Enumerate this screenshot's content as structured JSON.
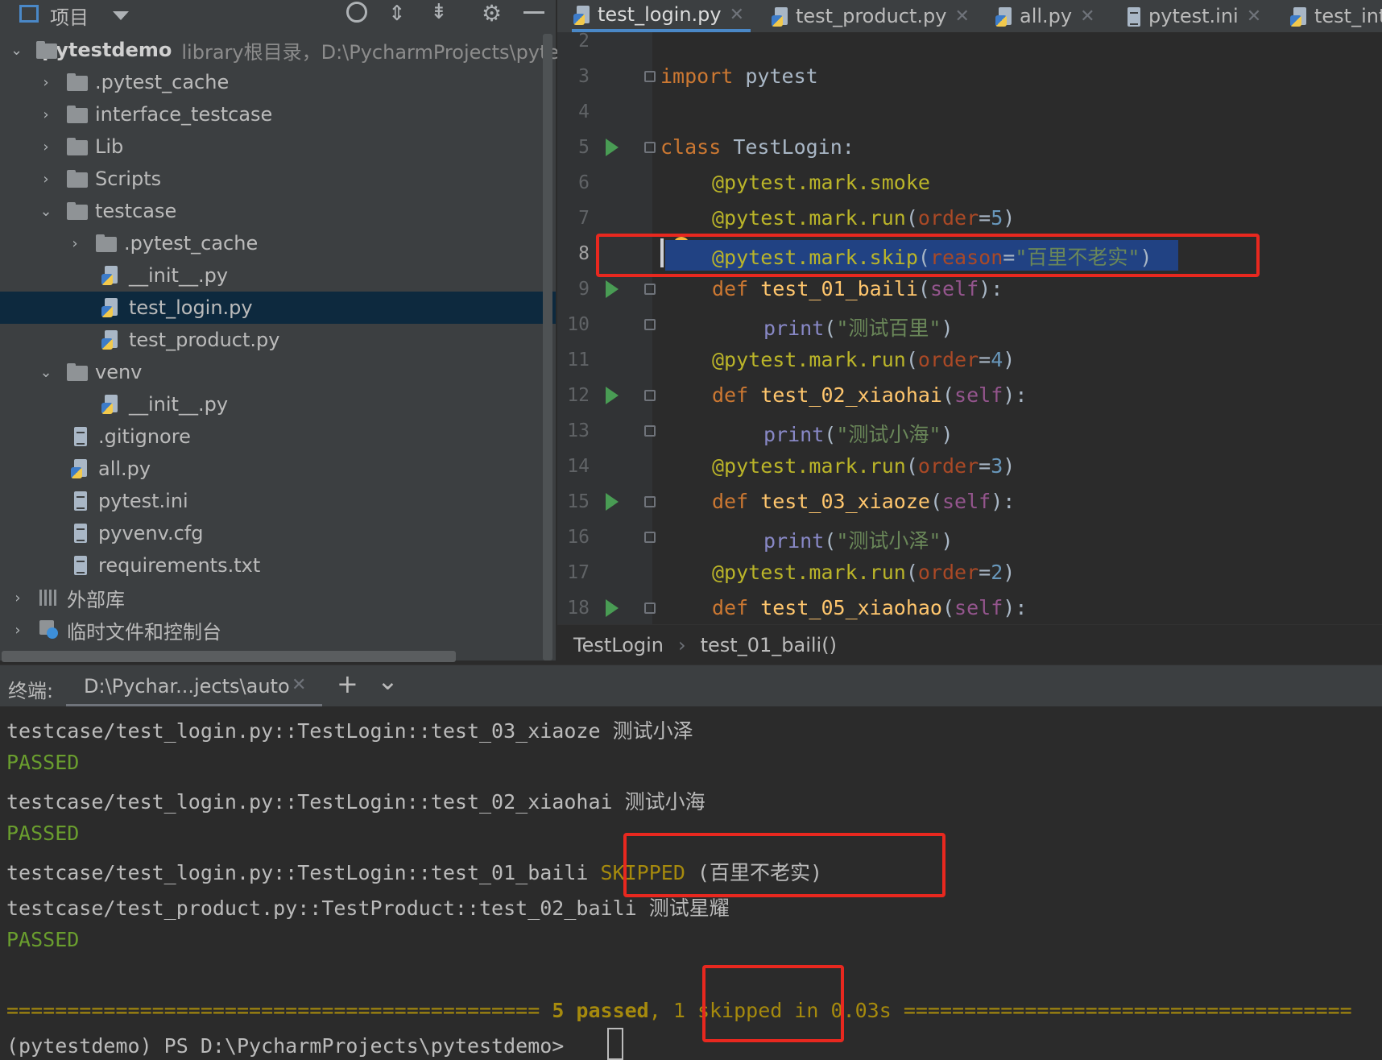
{
  "project_panel": {
    "title": "项目",
    "root_name": "pytestdemo",
    "root_desc": "library根目录，D:\\PycharmProjects\\pyte",
    "items": [
      {
        "label": ".pytest_cache"
      },
      {
        "label": "interface_testcase"
      },
      {
        "label": "Lib"
      },
      {
        "label": "Scripts"
      },
      {
        "label": "testcase"
      },
      {
        "label": ".pytest_cache"
      },
      {
        "label": "__init__.py"
      },
      {
        "label": "test_login.py"
      },
      {
        "label": "test_product.py"
      },
      {
        "label": "venv"
      },
      {
        "label": "__init__.py"
      },
      {
        "label": ".gitignore"
      },
      {
        "label": "all.py"
      },
      {
        "label": "pytest.ini"
      },
      {
        "label": "pyvenv.cfg"
      },
      {
        "label": "requirements.txt"
      },
      {
        "label": "外部库"
      },
      {
        "label": "临时文件和控制台"
      }
    ]
  },
  "tabs": [
    {
      "label": "test_login.py"
    },
    {
      "label": "test_product.py"
    },
    {
      "label": "all.py"
    },
    {
      "label": "pytest.ini"
    },
    {
      "label": "test_int"
    }
  ],
  "line_numbers": [
    "2",
    "3",
    "4",
    "5",
    "6",
    "7",
    "8",
    "9",
    "10",
    "11",
    "12",
    "13",
    "14",
    "15",
    "16",
    "17",
    "18"
  ],
  "code": {
    "import_kw": "import",
    "import_mod": " pytest",
    "class_kw": "class",
    "class_name": " TestLogin:",
    "l6": "@pytest.mark.smoke",
    "l7a": "@pytest.mark.run",
    "l7b": "(",
    "l7c": "order",
    "l7d": "=",
    "l7e": "5",
    "l7f": ")",
    "l8a": "@pytest.mark.skip",
    "l8b": "(",
    "l8c": "reason",
    "l8d": "=",
    "l8e": "\"百里不老实\"",
    "l8f": ")",
    "def": "def",
    "f1": " test_01_baili",
    "self": "self",
    "print": "print",
    "s1": "\"测试百里\"",
    "l11e": "4",
    "f2": " test_02_xiaohai",
    "s2": "\"测试小海\"",
    "l14e": "3",
    "f3": " test_03_xiaoze",
    "s3": "\"测试小泽\"",
    "l17e": "2",
    "f4": " test_05_xiaohao"
  },
  "breadcrumb": {
    "item1": "TestLogin",
    "sep": "›",
    "item2": "test_01_baili()"
  },
  "terminal_header": {
    "label": "终端:",
    "tab": "D:\\Pychar...jects\\auto",
    "plus": "+",
    "chevron": "⌄"
  },
  "terminal": {
    "l1": "testcase/test_login.py::TestLogin::test_03_xiaoze 测试小泽",
    "l2": "PASSED",
    "l3": "testcase/test_login.py::TestLogin::test_02_xiaohai 测试小海",
    "l4": "PASSED",
    "l5a": "testcase/test_login.py::TestLogin::test_01_baili ",
    "l5b": "SKIPPED",
    "l5c": " (百里不老实)",
    "l6": "testcase/test_product.py::TestProduct::test_02_baili 测试星耀",
    "l7": "PASSED",
    "sum_a": "============================================ ",
    "sum_b": "5 passed",
    "sum_c": ", ",
    "sum_d": "1 skipped",
    "sum_e": " in 0.03s",
    "sum_f": " =====================================",
    "prompt": "(pytestdemo) PS D:\\PycharmProjects\\pytestdemo> "
  },
  "colors": {
    "highlight": "#e8281f",
    "selection": "#214283",
    "accent": "#4a88c7"
  }
}
